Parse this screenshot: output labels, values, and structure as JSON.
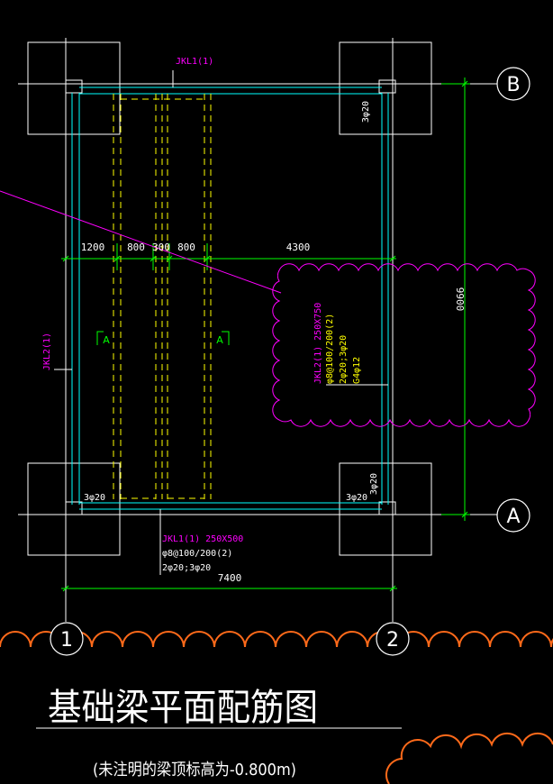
{
  "drawing": {
    "title": "基础梁平面配筋图",
    "subtitle": "(未注明的梁顶标高为-0.800m)"
  },
  "axes": {
    "B": "B",
    "A": "A",
    "one": "1",
    "two": "2"
  },
  "beams": {
    "jkl1_top": "JKL1(1)",
    "jkl2_left": "JKL2(1)",
    "jkl1_bottom": [
      "JKL1(1) 250X500",
      "φ8@100/200(2)",
      "2φ20;3φ20"
    ],
    "jkl2_note": [
      "JKL2(1) 250X750",
      "φ8@100/200(2)",
      "2φ20;3φ20",
      "G4φ12"
    ]
  },
  "dimensions": {
    "d1200": "1200",
    "d800a": "800",
    "d300": "300",
    "d800b": "800",
    "d4300": "4300",
    "d9900": "9900",
    "d7400": "7400"
  },
  "rebar": {
    "top_right": "3φ20",
    "bottom_right_v": "3φ20",
    "bottom_left": "3φ20",
    "bottom_right_h": "3φ20"
  },
  "sections": {
    "left": "A",
    "right": "A"
  },
  "colors": {
    "background": "#000000",
    "grid": "#ffffff",
    "beam": "#00ffff",
    "dim": "#00ff00",
    "pad": "#ffff00",
    "magenta": "#ff00ff",
    "cloud": "#ff6a1a"
  }
}
